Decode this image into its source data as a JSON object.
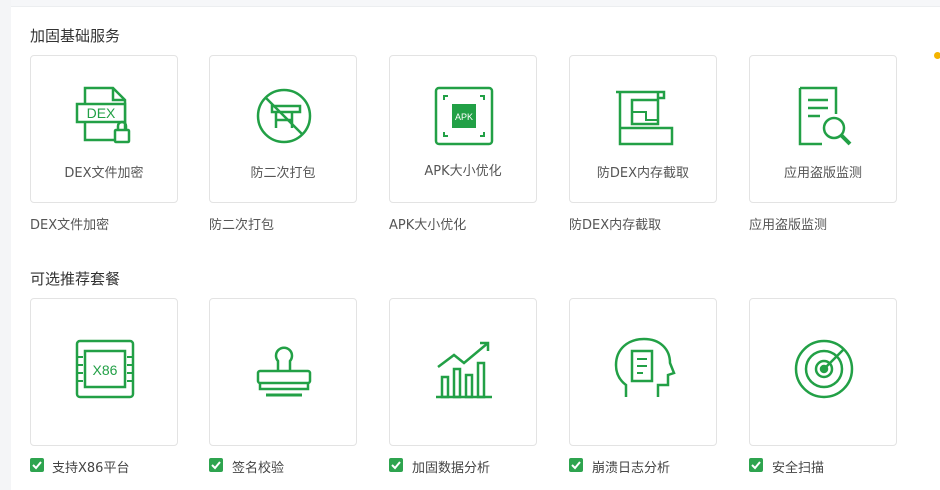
{
  "accent": "#22a046",
  "sections": {
    "basic": {
      "title": "加固基础服务"
    },
    "optional": {
      "title": "可选推荐套餐"
    }
  },
  "basic_items": [
    {
      "icon": "dex-file-lock-icon",
      "card_label": "DEX文件加密",
      "caption": "DEX文件加密",
      "icon_text": "DEX"
    },
    {
      "icon": "no-repackage-icon",
      "card_label": "防二次打包",
      "caption": "防二次打包"
    },
    {
      "icon": "apk-chip-icon",
      "card_label": "APK大小优化",
      "caption": "APK大小优化",
      "icon_text": "APK"
    },
    {
      "icon": "memory-clamp-icon",
      "card_label": "防DEX内存截取",
      "caption": "防DEX内存截取"
    },
    {
      "icon": "document-search-icon",
      "card_label": "应用盗版监测",
      "caption": "应用盗版监测"
    }
  ],
  "optional_items": [
    {
      "icon": "x86-chip-icon",
      "label": "支持X86平台",
      "checked": true,
      "icon_text": "X86"
    },
    {
      "icon": "stamp-icon",
      "label": "签名校验",
      "checked": true
    },
    {
      "icon": "growth-chart-icon",
      "label": "加固数据分析",
      "checked": true
    },
    {
      "icon": "head-log-icon",
      "label": "崩溃日志分析",
      "checked": true
    },
    {
      "icon": "radar-scan-icon",
      "label": "安全扫描",
      "checked": true
    }
  ]
}
